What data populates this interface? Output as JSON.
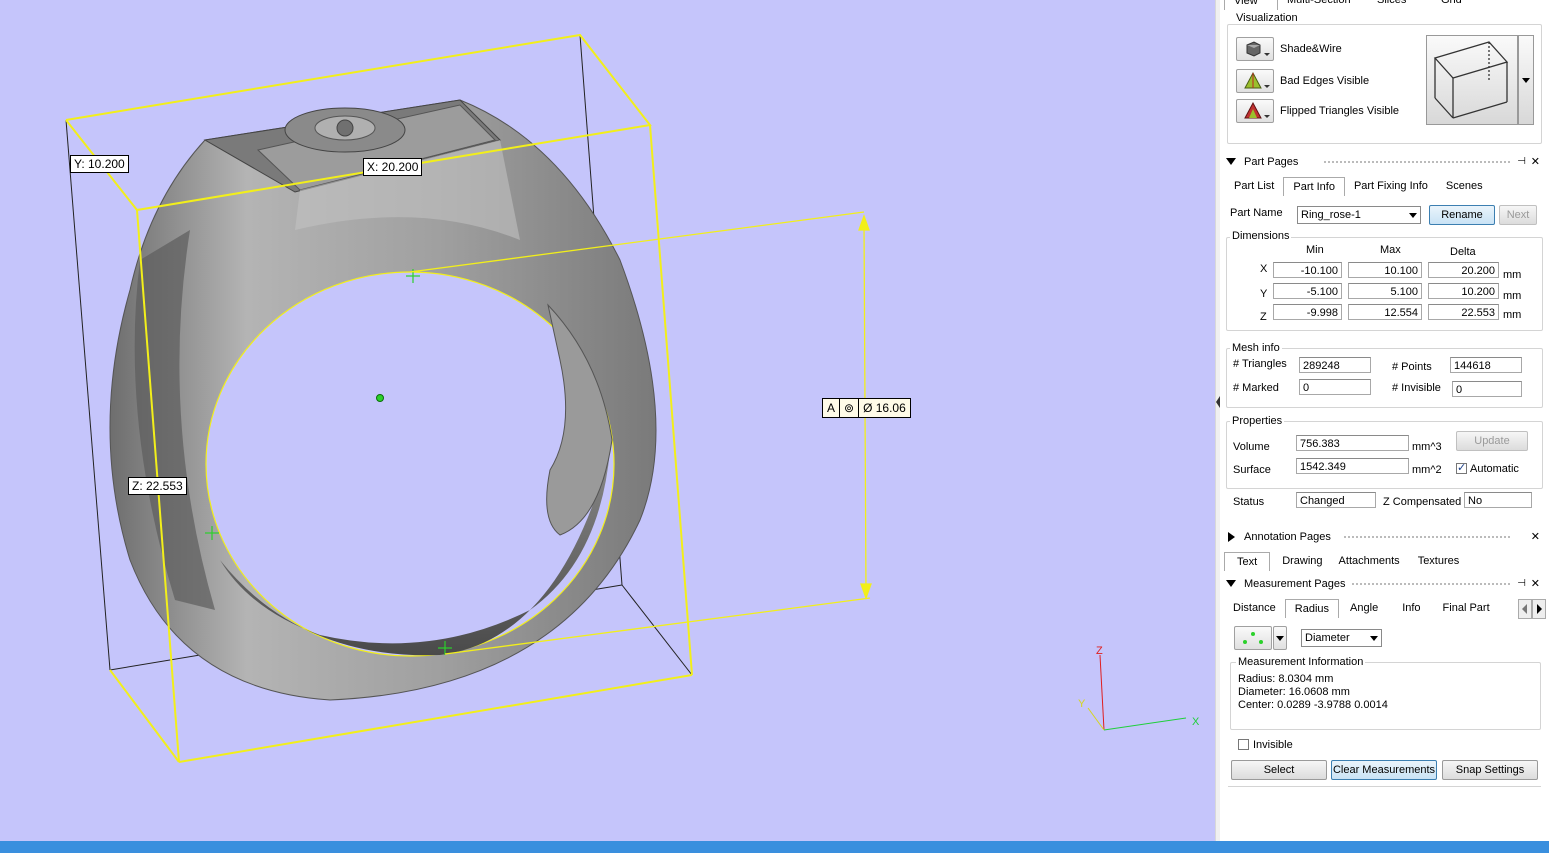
{
  "viewport": {
    "bbox_labels": {
      "y": "Y: 10.200",
      "x": "X: 20.200",
      "z": "Z: 22.553"
    },
    "measurement_tag": {
      "ref": "A",
      "symbol": "⊚",
      "value": "Ø 16.06"
    },
    "axes": {
      "z": "Z",
      "x": "X",
      "y": "Y"
    },
    "colors": {
      "background": "#c5c5fb",
      "bbox": "#f2ef1a",
      "ring": "#8d8d8d"
    }
  },
  "top_tabs": [
    "View",
    "Multi-Section",
    "Slices",
    "Grid"
  ],
  "visualization": {
    "title": "Visualization",
    "items": [
      "Shade&Wire",
      "Bad Edges Visible",
      "Flipped Triangles Visible"
    ]
  },
  "part_pages": {
    "title": "Part Pages",
    "tabs": [
      "Part List",
      "Part Info",
      "Part Fixing Info",
      "Scenes"
    ],
    "part_name_label": "Part Name",
    "part_name_value": "Ring_rose-1",
    "rename_label": "Rename",
    "next_label": "Next",
    "dimensions": {
      "title": "Dimensions",
      "headers": [
        "Min",
        "Max",
        "Delta"
      ],
      "rows": [
        {
          "axis": "X",
          "min": "-10.100",
          "max": "10.100",
          "delta": "20.200",
          "unit": "mm"
        },
        {
          "axis": "Y",
          "min": "-5.100",
          "max": "5.100",
          "delta": "10.200",
          "unit": "mm"
        },
        {
          "axis": "Z",
          "min": "-9.998",
          "max": "12.554",
          "delta": "22.553",
          "unit": "mm"
        }
      ]
    },
    "mesh_info": {
      "title": "Mesh info",
      "triangles_label": "# Triangles",
      "triangles": "289248",
      "points_label": "# Points",
      "points": "144618",
      "marked_label": "# Marked",
      "marked": "0",
      "invisible_label": "# Invisible",
      "invisible": "0"
    },
    "properties": {
      "title": "Properties",
      "volume_label": "Volume",
      "volume": "756.383",
      "volume_unit": "mm^3",
      "surface_label": "Surface",
      "surface": "1542.349",
      "surface_unit": "mm^2",
      "update_label": "Update",
      "automatic_label": "Automatic"
    },
    "status_label": "Status",
    "status": "Changed",
    "zcomp_label": "Z Compensated",
    "zcomp": "No"
  },
  "annotation_pages": {
    "title": "Annotation Pages",
    "tabs": [
      "Text",
      "Drawing",
      "Attachments",
      "Textures"
    ]
  },
  "measurement_pages": {
    "title": "Measurement Pages",
    "tabs": [
      "Distance",
      "Radius",
      "Angle",
      "Info",
      "Final Part"
    ],
    "mode_value": "Diameter",
    "info_title": "Measurement Information",
    "lines": [
      "Radius: 8.0304 mm",
      "Diameter: 16.0608 mm",
      "Center: 0.0289  -3.9788  0.0014"
    ],
    "invisible_label": "Invisible",
    "select_label": "Select",
    "clear_label": "Clear Measurements",
    "snap_label": "Snap Settings"
  }
}
